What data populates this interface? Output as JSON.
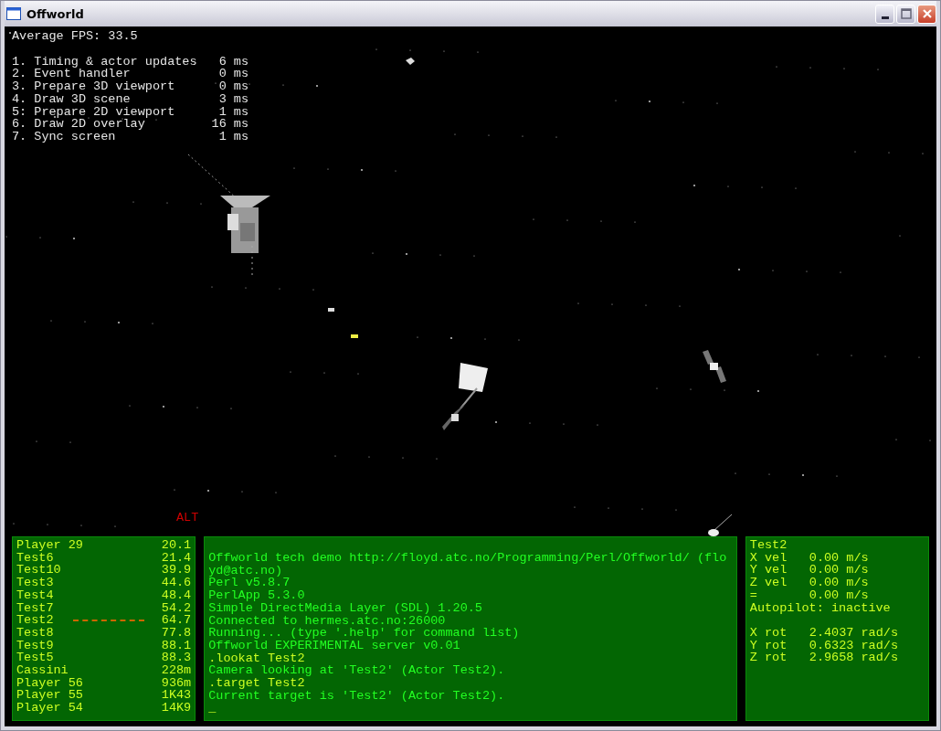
{
  "window": {
    "title": "Offworld"
  },
  "fps": "Average FPS: 33.5",
  "timings": [
    {
      "label": "1. Timing & actor updates",
      "value": "6 ms"
    },
    {
      "label": "2. Event handler",
      "value": "0 ms"
    },
    {
      "label": "3. Prepare 3D viewport",
      "value": "0 ms"
    },
    {
      "label": "4. Draw 3D scene",
      "value": "3 ms"
    },
    {
      "label": "5: Prepare 2D viewport",
      "value": "1 ms"
    },
    {
      "label": "6. Draw 2D overlay",
      "value": "16 ms"
    },
    {
      "label": "7. Sync screen",
      "value": "1 ms"
    }
  ],
  "alt_label": "ALT",
  "actors": [
    {
      "name": "Player 29",
      "distance": "20.1",
      "selected": false
    },
    {
      "name": "Test6",
      "distance": "21.4",
      "selected": false
    },
    {
      "name": "Test10",
      "distance": "39.9",
      "selected": false
    },
    {
      "name": "Test3",
      "distance": "44.6",
      "selected": false
    },
    {
      "name": "Test4",
      "distance": "48.4",
      "selected": false
    },
    {
      "name": "Test7",
      "distance": "54.2",
      "selected": false
    },
    {
      "name": "Test2",
      "distance": "64.7",
      "selected": true
    },
    {
      "name": "Test8",
      "distance": "77.8",
      "selected": false
    },
    {
      "name": "Test9",
      "distance": "88.1",
      "selected": false
    },
    {
      "name": "Test5",
      "distance": "88.3",
      "selected": false
    },
    {
      "name": "Cassini",
      "distance": "228m",
      "selected": false
    },
    {
      "name": "Player 56",
      "distance": "936m",
      "selected": false
    },
    {
      "name": "Player 55",
      "distance": "1K43",
      "selected": false
    },
    {
      "name": "Player 54",
      "distance": "14K9",
      "selected": false
    }
  ],
  "console": {
    "lines": [
      {
        "kind": "output",
        "text": "Offworld tech demo http://floyd.atc.no/Programming/Perl/Offworld/ (floyd@atc.no)"
      },
      {
        "kind": "output",
        "text": "Perl v5.8.7"
      },
      {
        "kind": "output",
        "text": "PerlApp 5.3.0"
      },
      {
        "kind": "output",
        "text": "Simple DirectMedia Layer (SDL) 1.20.5"
      },
      {
        "kind": "output",
        "text": "Connected to hermes.atc.no:26000"
      },
      {
        "kind": "output",
        "text": "Running... (type '.help' for command list)"
      },
      {
        "kind": "output",
        "text": "Offworld EXPERIMENTAL server v0.01"
      },
      {
        "kind": "command",
        "text": ".lookat Test2"
      },
      {
        "kind": "output",
        "text": "Camera looking at 'Test2' (Actor Test2)."
      },
      {
        "kind": "command",
        "text": ".target Test2"
      },
      {
        "kind": "output",
        "text": "Current target is 'Test2' (Actor Test2)."
      }
    ],
    "prompt": "_"
  },
  "target": {
    "name": "Test2",
    "velocity": [
      {
        "label": "X vel",
        "value": "0.00 m/s"
      },
      {
        "label": "Y vel",
        "value": "0.00 m/s"
      },
      {
        "label": "Z vel",
        "value": "0.00 m/s"
      },
      {
        "label": "=",
        "value": "0.00 m/s"
      }
    ],
    "autopilot": "Autopilot: inactive",
    "rotation": [
      {
        "label": "X rot",
        "value": "2.4037 rad/s"
      },
      {
        "label": "Y rot",
        "value": "0.6323 rad/s"
      },
      {
        "label": "Z rot",
        "value": "2.9658 rad/s"
      }
    ]
  }
}
